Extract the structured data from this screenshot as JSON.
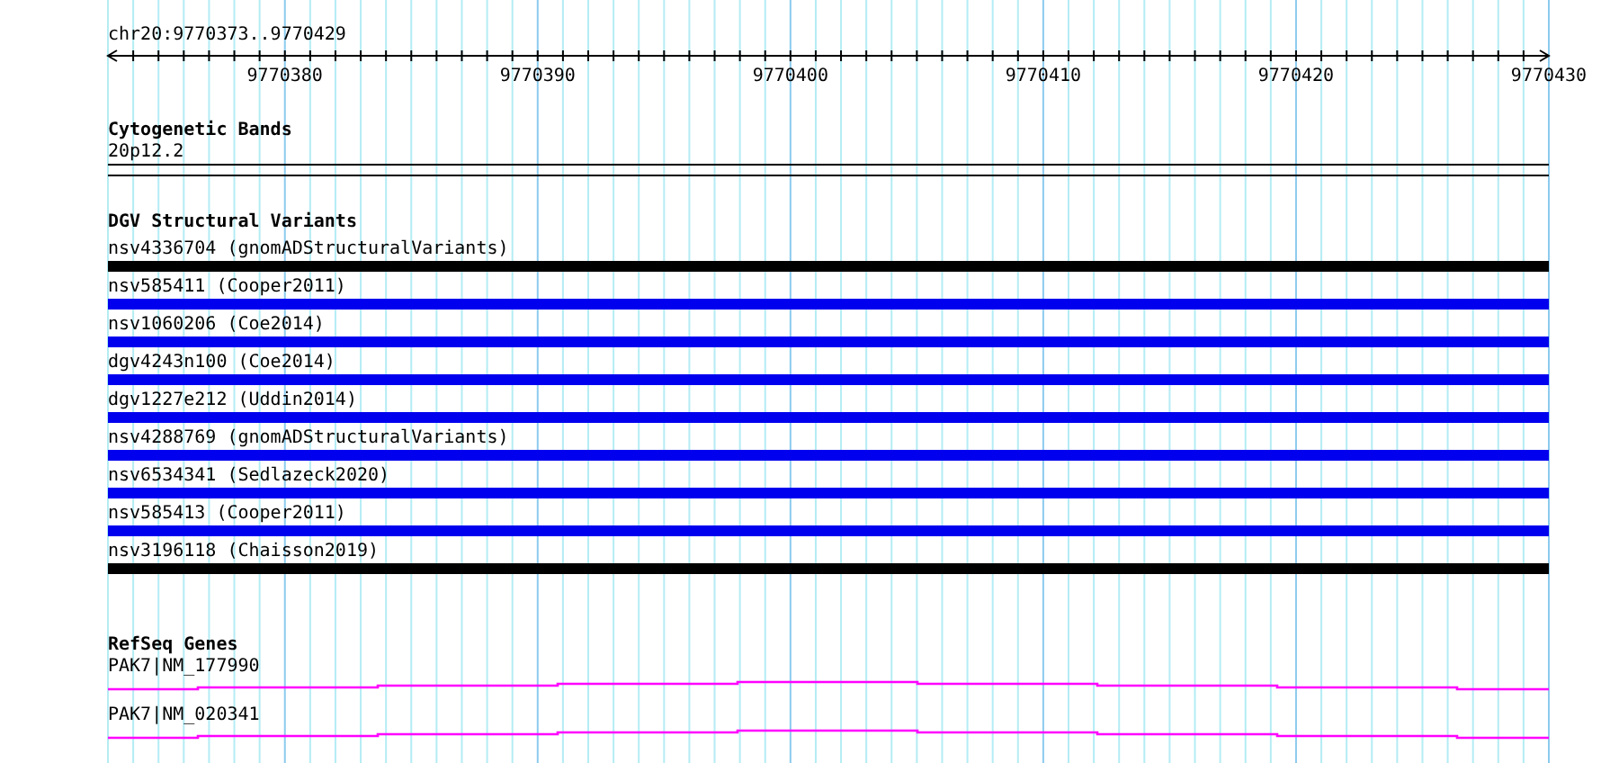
{
  "ruler": {
    "position": "chr20:9770373..9770429",
    "tick_labels": [
      "9770380",
      "9770390",
      "9770400",
      "9770410",
      "9770420",
      "9770430"
    ]
  },
  "tracks": [
    {
      "kind": "bands",
      "title": "Cytogenetic Bands",
      "items": [
        {
          "label": "20p12.2"
        }
      ]
    },
    {
      "kind": "variants",
      "title": "DGV Structural Variants",
      "items": [
        {
          "label": "nsv4336704 (gnomADStructuralVariants)",
          "color": "#000000"
        },
        {
          "label": "nsv585411 (Cooper2011)",
          "color": "#0000ee"
        },
        {
          "label": "nsv1060206 (Coe2014)",
          "color": "#0000ee"
        },
        {
          "label": "dgv4243n100 (Coe2014)",
          "color": "#0000ee"
        },
        {
          "label": "dgv1227e212 (Uddin2014)",
          "color": "#0000ee"
        },
        {
          "label": "nsv4288769 (gnomADStructuralVariants)",
          "color": "#0000ee"
        },
        {
          "label": "nsv6534341 (Sedlazeck2020)",
          "color": "#0000ee"
        },
        {
          "label": "nsv585413 (Cooper2011)",
          "color": "#0000ee"
        },
        {
          "label": "nsv3196118 (Chaisson2019)",
          "color": "#000000"
        }
      ]
    },
    {
      "kind": "genes",
      "title": "RefSeq Genes",
      "items": [
        {
          "label": "PAK7|NM_177990"
        },
        {
          "label": "PAK7|NM_020341"
        }
      ]
    }
  ]
}
